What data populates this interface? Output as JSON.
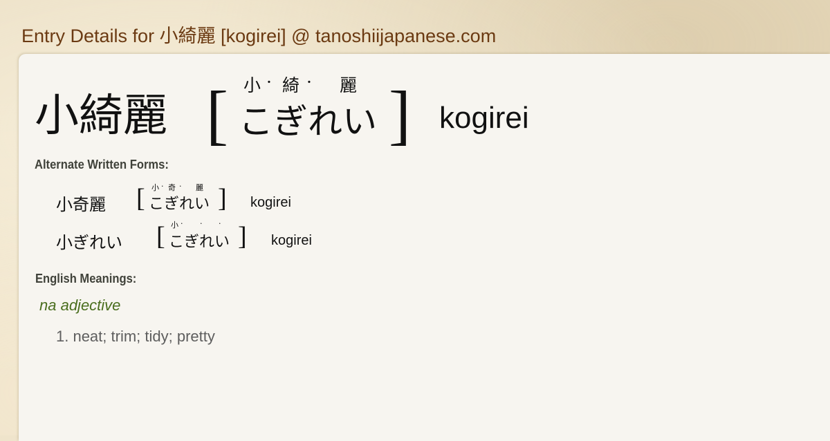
{
  "page": {
    "title": "Entry Details for 小綺麗 [kogirei] @ tanoshiijapanese.com"
  },
  "entry": {
    "headword": "小綺麗",
    "bracket_open": "[",
    "bracket_close": "]",
    "furigana": [
      "小",
      "·",
      "綺",
      "·",
      "麗"
    ],
    "kana": "こぎれい",
    "romaji": "kogirei"
  },
  "alternate_forms": {
    "label": "Alternate Written Forms:",
    "items": [
      {
        "written": "小奇麗",
        "furigana": [
          "小",
          "·",
          "奇",
          "·",
          "麗"
        ],
        "kana": "こぎれい",
        "romaji": "kogirei"
      },
      {
        "written": "小ぎれい",
        "furigana": [
          "小",
          "·",
          "",
          "·",
          "",
          "·"
        ],
        "kana": "こぎれい",
        "romaji": "kogirei"
      }
    ]
  },
  "meanings": {
    "label": "English Meanings:",
    "part_of_speech": "na adjective",
    "definitions": [
      "1. neat; trim; tidy; pretty"
    ]
  },
  "colors": {
    "title": "#6b3a12",
    "part_of_speech": "#4a6e1e",
    "definition": "#5e5e5e",
    "panel": "#f7f5f0"
  }
}
